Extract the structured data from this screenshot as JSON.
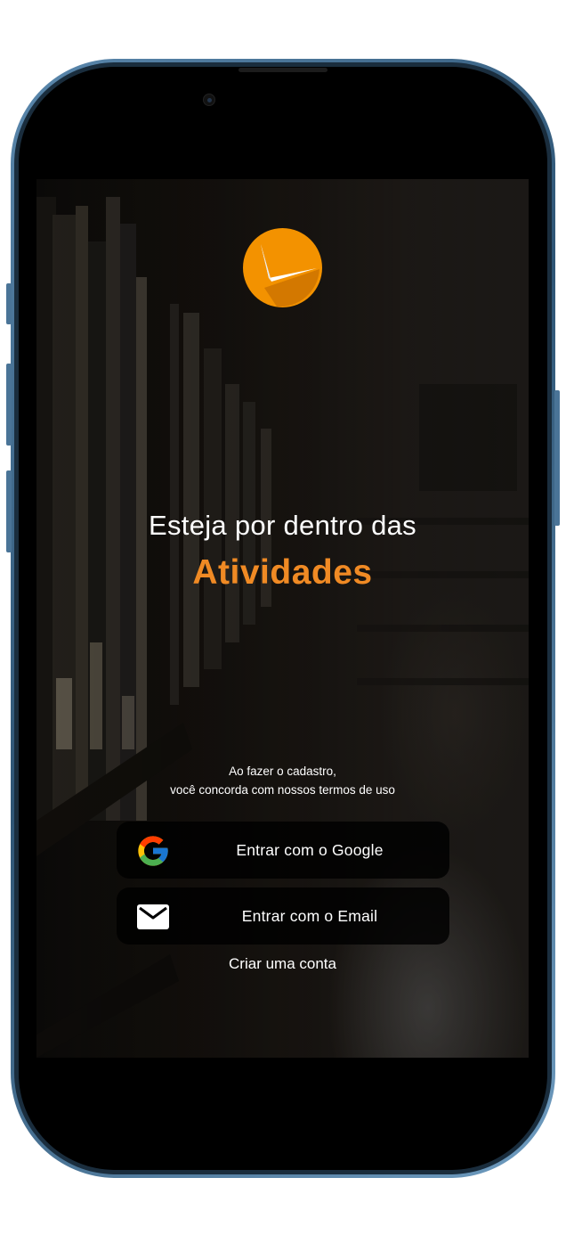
{
  "headline": {
    "line1": "Esteja por dentro das",
    "accent": "Atividades",
    "accent_color": "#f08a24"
  },
  "logo": {
    "icon": "check-logo-icon",
    "color": "#f39200"
  },
  "terms": {
    "line1": "Ao fazer o cadastro,",
    "line2": "você concorda com nossos termos de uso"
  },
  "buttons": {
    "google": {
      "label": "Entrar com o Google",
      "icon": "google-icon"
    },
    "email": {
      "label": "Entrar com o Email",
      "icon": "mail-icon"
    }
  },
  "create_account": {
    "label": "Criar uma conta"
  }
}
